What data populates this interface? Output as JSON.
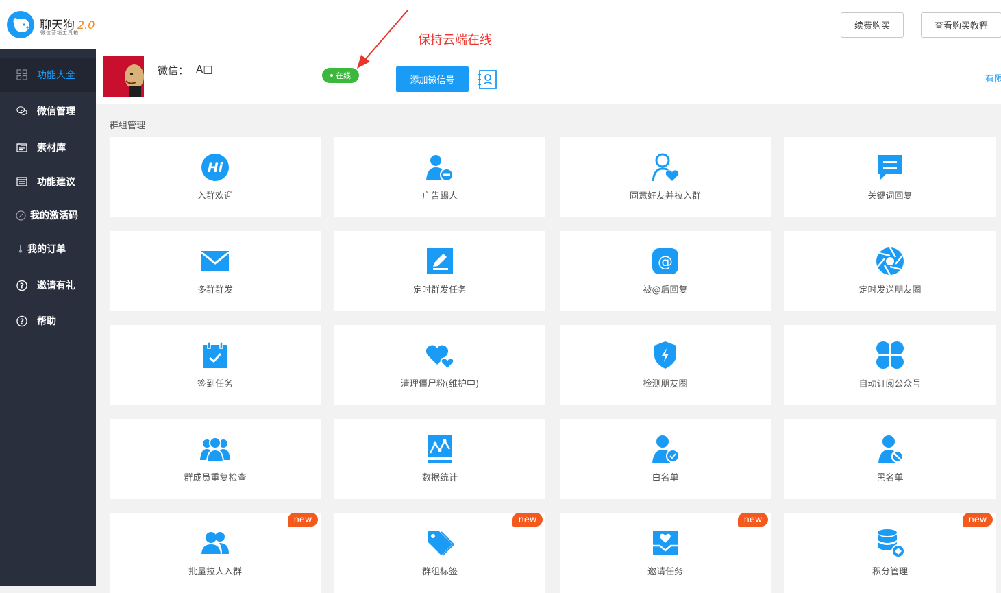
{
  "app": {
    "brand": "聊天狗",
    "version": "2.0",
    "tagline": "微信营销工具箱"
  },
  "header": {
    "renew_label": "续费购买",
    "tutorial_label": "查看购买教程"
  },
  "sidebar": {
    "items": [
      {
        "label": "功能大全",
        "icon": "grid-icon",
        "active": true
      },
      {
        "label": "微信管理",
        "icon": "wechat-icon",
        "active": false
      },
      {
        "label": "素材库",
        "icon": "folder-icon",
        "active": false
      },
      {
        "label": "功能建议",
        "icon": "list-icon",
        "active": false
      },
      {
        "label": "我的激活码",
        "icon": "key-icon",
        "active": false
      },
      {
        "label": "我的订单",
        "icon": "thermometer-icon",
        "active": false
      },
      {
        "label": "邀请有礼",
        "icon": "question-icon",
        "active": false
      },
      {
        "label": "帮助",
        "icon": "question-icon",
        "active": false
      }
    ]
  },
  "account": {
    "wx_label": "微信：",
    "wx_name": "A□",
    "status": "在线",
    "add_label": "添加微信号",
    "right_link": "有限"
  },
  "annotation": {
    "text": "保持云端在线"
  },
  "section": {
    "title": "群组管理"
  },
  "colors": {
    "accent": "#1a9bf5",
    "sidebar_bg": "#2a2f3e",
    "online_green": "#3cb93c",
    "new_badge": "#f45a1e",
    "annotation_red": "#e8352e"
  },
  "cards": [
    {
      "label": "入群欢迎",
      "icon": "hi-icon",
      "new": false
    },
    {
      "label": "广告踢人",
      "icon": "user-minus-icon",
      "new": false
    },
    {
      "label": "同意好友并拉入群",
      "icon": "user-heart-icon",
      "new": false
    },
    {
      "label": "关键词回复",
      "icon": "message-icon",
      "new": false
    },
    {
      "label": "多群群发",
      "icon": "mail-icon",
      "new": false
    },
    {
      "label": "定时群发任务",
      "icon": "edit-icon",
      "new": false
    },
    {
      "label": "被@后回复",
      "icon": "at-icon",
      "new": false
    },
    {
      "label": "定时发送朋友圈",
      "icon": "aperture-icon",
      "new": false
    },
    {
      "label": "签到任务",
      "icon": "calendar-check-icon",
      "new": false
    },
    {
      "label": "清理僵尸粉(维护中)",
      "icon": "hearts-icon",
      "new": false
    },
    {
      "label": "检测朋友圈",
      "icon": "shield-icon",
      "new": false
    },
    {
      "label": "自动订阅公众号",
      "icon": "clover-icon",
      "new": false
    },
    {
      "label": "群成员重复检查",
      "icon": "users-icon",
      "new": false
    },
    {
      "label": "数据统计",
      "icon": "chart-icon",
      "new": false
    },
    {
      "label": "白名单",
      "icon": "user-check-icon",
      "new": false
    },
    {
      "label": "黑名单",
      "icon": "user-block-icon",
      "new": false
    },
    {
      "label": "批量拉人入群",
      "icon": "user-group-icon",
      "new": true,
      "badge": "new"
    },
    {
      "label": "群组标签",
      "icon": "tag-icon",
      "new": true,
      "badge": "new"
    },
    {
      "label": "邀请任务",
      "icon": "inbox-heart-icon",
      "new": true,
      "badge": "new"
    },
    {
      "label": "积分管理",
      "icon": "database-icon",
      "new": true,
      "badge": "new"
    }
  ]
}
